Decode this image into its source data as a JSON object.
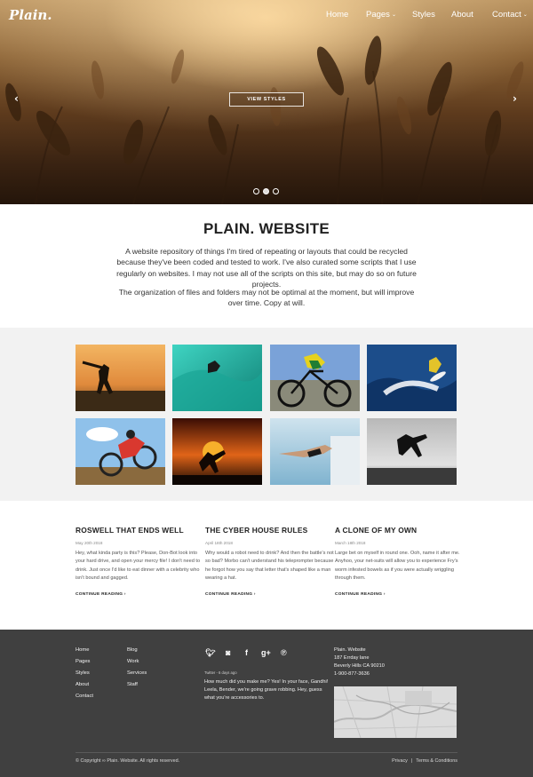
{
  "brand": {
    "logo": "Plain."
  },
  "nav": {
    "items": [
      {
        "label": "Home",
        "caret": ""
      },
      {
        "label": "Pages",
        "caret": "⌄"
      },
      {
        "label": "Styles",
        "caret": ""
      },
      {
        "label": "About",
        "caret": ""
      },
      {
        "label": "Contact",
        "caret": "⌄"
      }
    ]
  },
  "hero": {
    "button_label": "VIEW STYLES",
    "prev_arrow": "‹",
    "next_arrow": "›",
    "slide_count": 3,
    "active_slide": 1
  },
  "intro": {
    "title": "PLAIN. WEBSITE",
    "paragraph1": "A website repository of things I'm tired of repeating or layouts that could be recycled because they've been coded and tested to work. I've also curated some scripts that I use regularly on websites. I may not use all of the scripts on this site, but may do so on future projects.",
    "paragraph2": "The organization of files and folders may not be optimal at the moment, but will improve over time. Copy at will."
  },
  "gallery": {
    "images": [
      {
        "icon": "baseball-batter-photo"
      },
      {
        "icon": "surfer-wave-photo"
      },
      {
        "icon": "cyclist-photo"
      },
      {
        "icon": "surfer-spray-photo"
      },
      {
        "icon": "motocross-photo"
      },
      {
        "icon": "sunset-kick-photo"
      },
      {
        "icon": "swimmer-photo"
      },
      {
        "icon": "beach-jump-photo"
      }
    ]
  },
  "posts": [
    {
      "title": "ROSWELL THAT ENDS WELL",
      "date": "May 20th 2018",
      "excerpt": "Hey, what kinda party is this? Please, Don-Bot look into your hard drive, and open your mercy file! I don't need to drink. Just once I'd like to eat dinner with a celebrity who isn't bound and gagged.",
      "more": "CONTINUE READING ›"
    },
    {
      "title": "THE CYBER HOUSE RULES",
      "date": "April 18th 2018",
      "excerpt": "Why would a robot need to drink? And then the battle's not so bad? Morbo can't understand his teleprompter because he forgot how you say that letter that's shaped like a man wearing a hat.",
      "more": "CONTINUE READING ›"
    },
    {
      "title": "A CLONE OF MY OWN",
      "date": "March 18th 2018",
      "excerpt": "Large bet on myself in round one. Ooh, name it after me. Anyhoo, your net-suits will allow you to experience Fry's worm infested bowels as if you were actually wriggling through them.",
      "more": "CONTINUE READING ›"
    }
  ],
  "footer": {
    "col1": [
      "Home",
      "Pages",
      "Styles",
      "About",
      "Contact"
    ],
    "col2": [
      "Blog",
      "Work",
      "Services",
      "Staff"
    ],
    "social": [
      {
        "icon": "twitter-icon",
        "glyph": "🐦︎"
      },
      {
        "icon": "instagram-icon",
        "glyph": "◙"
      },
      {
        "icon": "facebook-icon",
        "glyph": "f"
      },
      {
        "icon": "googleplus-icon",
        "glyph": "g+"
      },
      {
        "icon": "pinterest-icon",
        "glyph": "℗"
      }
    ],
    "tweet_meta": "Twitter - 6 days ago",
    "tweet_text": "How much did you make me? Yes! In your face, Gandhi! Leela, Bender, we're going grave robbing. Hey, guess what you're accessories to.",
    "address": [
      "Plain. Website",
      "187 Errday lane",
      "Beverly Hills CA 90210",
      "1-900-877-3636"
    ],
    "copyright": "© Copyright ∞ Plain. Website. All rights reserved.",
    "privacy": "Privacy",
    "separator": "|",
    "terms": "Terms & Conditions"
  }
}
